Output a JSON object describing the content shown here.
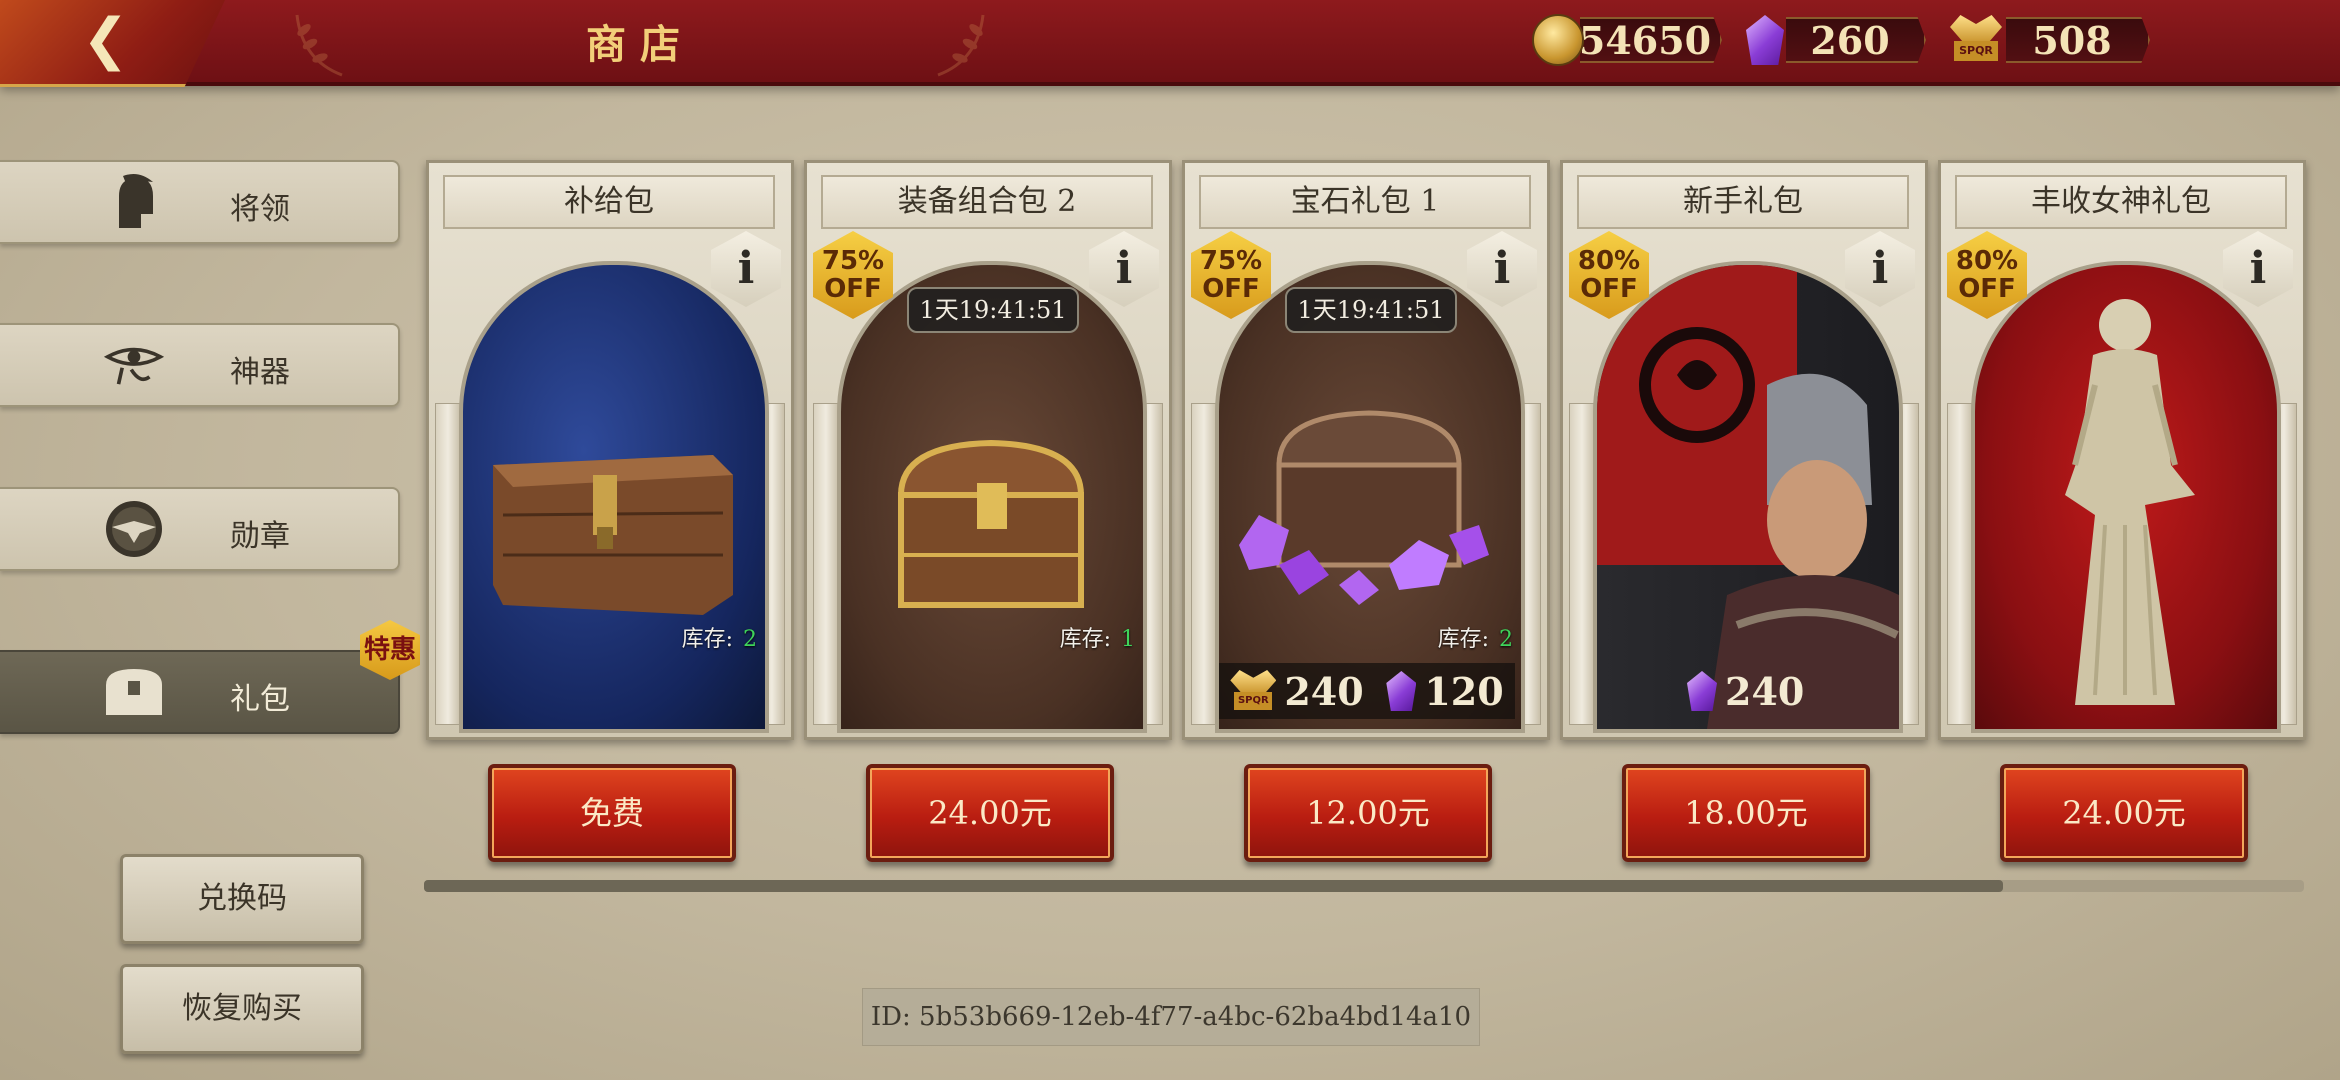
{
  "header": {
    "title": "商店",
    "back_icon": "back-chevron-icon"
  },
  "currencies": [
    {
      "icon": "gold-coin-icon",
      "value": "54650"
    },
    {
      "icon": "purple-gem-icon",
      "value": "260"
    },
    {
      "icon": "spqr-eagle-icon",
      "value": "508"
    }
  ],
  "sidebar": {
    "items": [
      {
        "label": "将领",
        "icon": "spartan-helmet-icon",
        "active": false
      },
      {
        "label": "神器",
        "icon": "eye-of-horus-icon",
        "active": false
      },
      {
        "label": "勋章",
        "icon": "eagle-medal-icon",
        "active": false
      },
      {
        "label": "礼包",
        "icon": "treasure-chest-icon",
        "active": true
      }
    ],
    "badge": "特惠",
    "redeem_label": "兑换码",
    "restore_label": "恢复购买"
  },
  "cards": [
    {
      "name": "补给包",
      "discount": "",
      "timer": "",
      "stock_label": "库存:",
      "stock": "2",
      "price": "免费",
      "bonus": []
    },
    {
      "name": "装备组合包 2",
      "discount": "75%\nOFF",
      "timer": "1天19:41:51",
      "stock_label": "库存:",
      "stock": "1",
      "price": "24.00元",
      "bonus": []
    },
    {
      "name": "宝石礼包 1",
      "discount": "75%\nOFF",
      "timer": "1天19:41:51",
      "stock_label": "库存:",
      "stock": "2",
      "price": "12.00元",
      "bonus": [
        {
          "icon": "spqr-eagle-icon",
          "value": "240"
        },
        {
          "icon": "purple-gem-icon",
          "value": "120"
        }
      ]
    },
    {
      "name": "新手礼包",
      "discount": "80%\nOFF",
      "timer": "",
      "stock_label": "",
      "stock": "",
      "price": "18.00元",
      "bonus": [
        {
          "icon": "purple-gem-icon",
          "value": "240"
        }
      ]
    },
    {
      "name": "丰收女神礼包",
      "discount": "80%\nOFF",
      "timer": "",
      "stock_label": "",
      "stock": "",
      "price": "24.00元",
      "bonus": []
    }
  ],
  "info_glyph": "i",
  "scroll_progress": 0.84,
  "footer": {
    "id_text": "ID: 5b53b669-12eb-4f77-a4bc-62ba4bd14a10"
  }
}
